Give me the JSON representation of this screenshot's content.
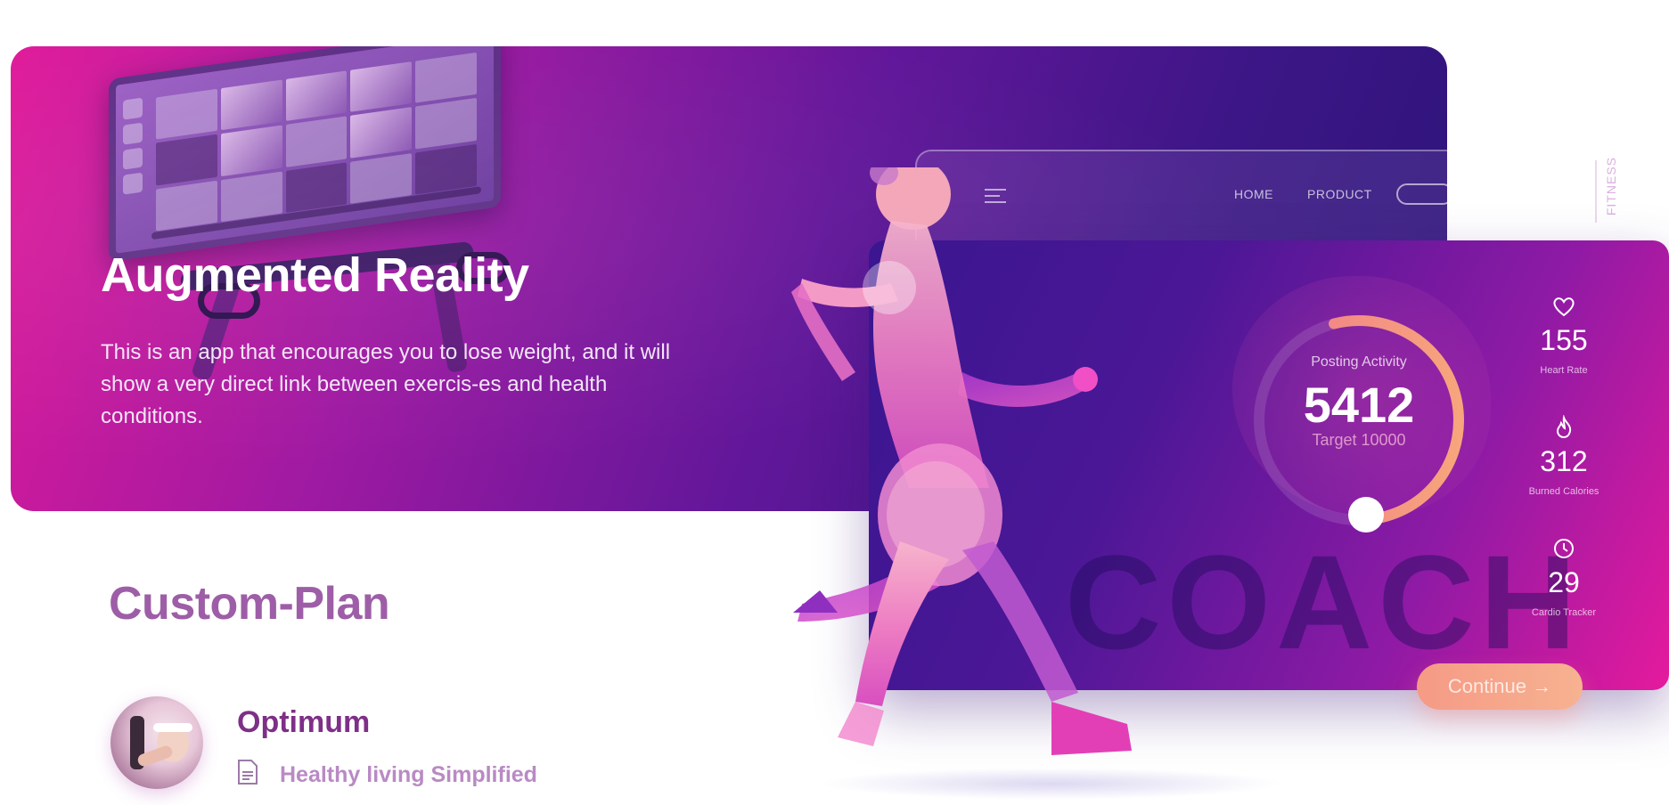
{
  "hero": {
    "title": "Augmented Reality",
    "description": "This is an app that encourages you to lose weight, and it will show a very direct link between exercis-es and health conditions."
  },
  "custom_plan": {
    "title": "Custom-Plan",
    "plan_name": "Optimum",
    "plan_subtitle": "Healthy living Simplified"
  },
  "website": {
    "nav": [
      "HOME",
      "PRODUCT"
    ],
    "brand_tag": "FITNESS"
  },
  "dashboard": {
    "activity_label": "Posting  Activity",
    "activity_value": "5412",
    "target": "Target 10000",
    "activity_progress": 0.54,
    "watermark": "COACH",
    "stats": [
      {
        "icon": "heart-icon",
        "value": "155",
        "label": "Heart Rate"
      },
      {
        "icon": "flame-icon",
        "value": "312",
        "label": "Burned Calories"
      },
      {
        "icon": "clock-icon",
        "value": "29",
        "label": "Cardio Tracker"
      }
    ],
    "continue_label": "Continue  →"
  },
  "colors": {
    "hero_start": "#e01a9a",
    "hero_end": "#2c1479",
    "accent_peach": "#f59a86",
    "title_purple": "#9d5ea7"
  }
}
